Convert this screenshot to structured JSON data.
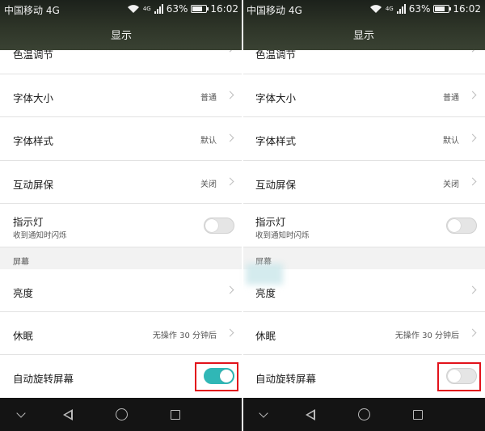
{
  "screens": [
    {
      "status": {
        "carrier": "中国移动 4G",
        "network_badge": "4G",
        "battery": "63%",
        "time": "16:02"
      },
      "title": "显示",
      "rows": {
        "color_temp": "色温调节",
        "font_size": {
          "label": "字体大小",
          "value": "普通"
        },
        "font_style": {
          "label": "字体样式",
          "value": "默认"
        },
        "screensaver": {
          "label": "互动屏保",
          "value": "关闭"
        },
        "indicator": {
          "label": "指示灯",
          "sub": "收到通知时闪烁",
          "toggle": "off"
        },
        "section_screen": "屏幕",
        "brightness": "亮度",
        "sleep": {
          "label": "休眠",
          "value": "无操作 30 分钟后"
        },
        "auto_rotate": {
          "label": "自动旋转屏幕",
          "toggle": "on"
        }
      }
    },
    {
      "status": {
        "carrier": "中国移动 4G",
        "network_badge": "4G",
        "battery": "63%",
        "time": "16:02"
      },
      "title": "显示",
      "rows": {
        "color_temp": "色温调节",
        "font_size": {
          "label": "字体大小",
          "value": "普通"
        },
        "font_style": {
          "label": "字体样式",
          "value": "默认"
        },
        "screensaver": {
          "label": "互动屏保",
          "value": "关闭"
        },
        "indicator": {
          "label": "指示灯",
          "sub": "收到通知时闪烁",
          "toggle": "off"
        },
        "section_screen": "屏幕",
        "brightness": "亮度",
        "sleep": {
          "label": "休眠",
          "value": "无操作 30 分钟后"
        },
        "auto_rotate": {
          "label": "自动旋转屏幕",
          "toggle": "off"
        }
      }
    }
  ],
  "colors": {
    "toggle_on": "#30b7b6",
    "highlight": "#e2121b",
    "header": "#2e3528",
    "navbar": "#141414"
  },
  "icons": [
    "wifi-icon",
    "signal-icon",
    "battery-icon",
    "chevron-right-icon",
    "nav-down-icon",
    "nav-back-icon",
    "nav-home-icon",
    "nav-recent-icon"
  ]
}
